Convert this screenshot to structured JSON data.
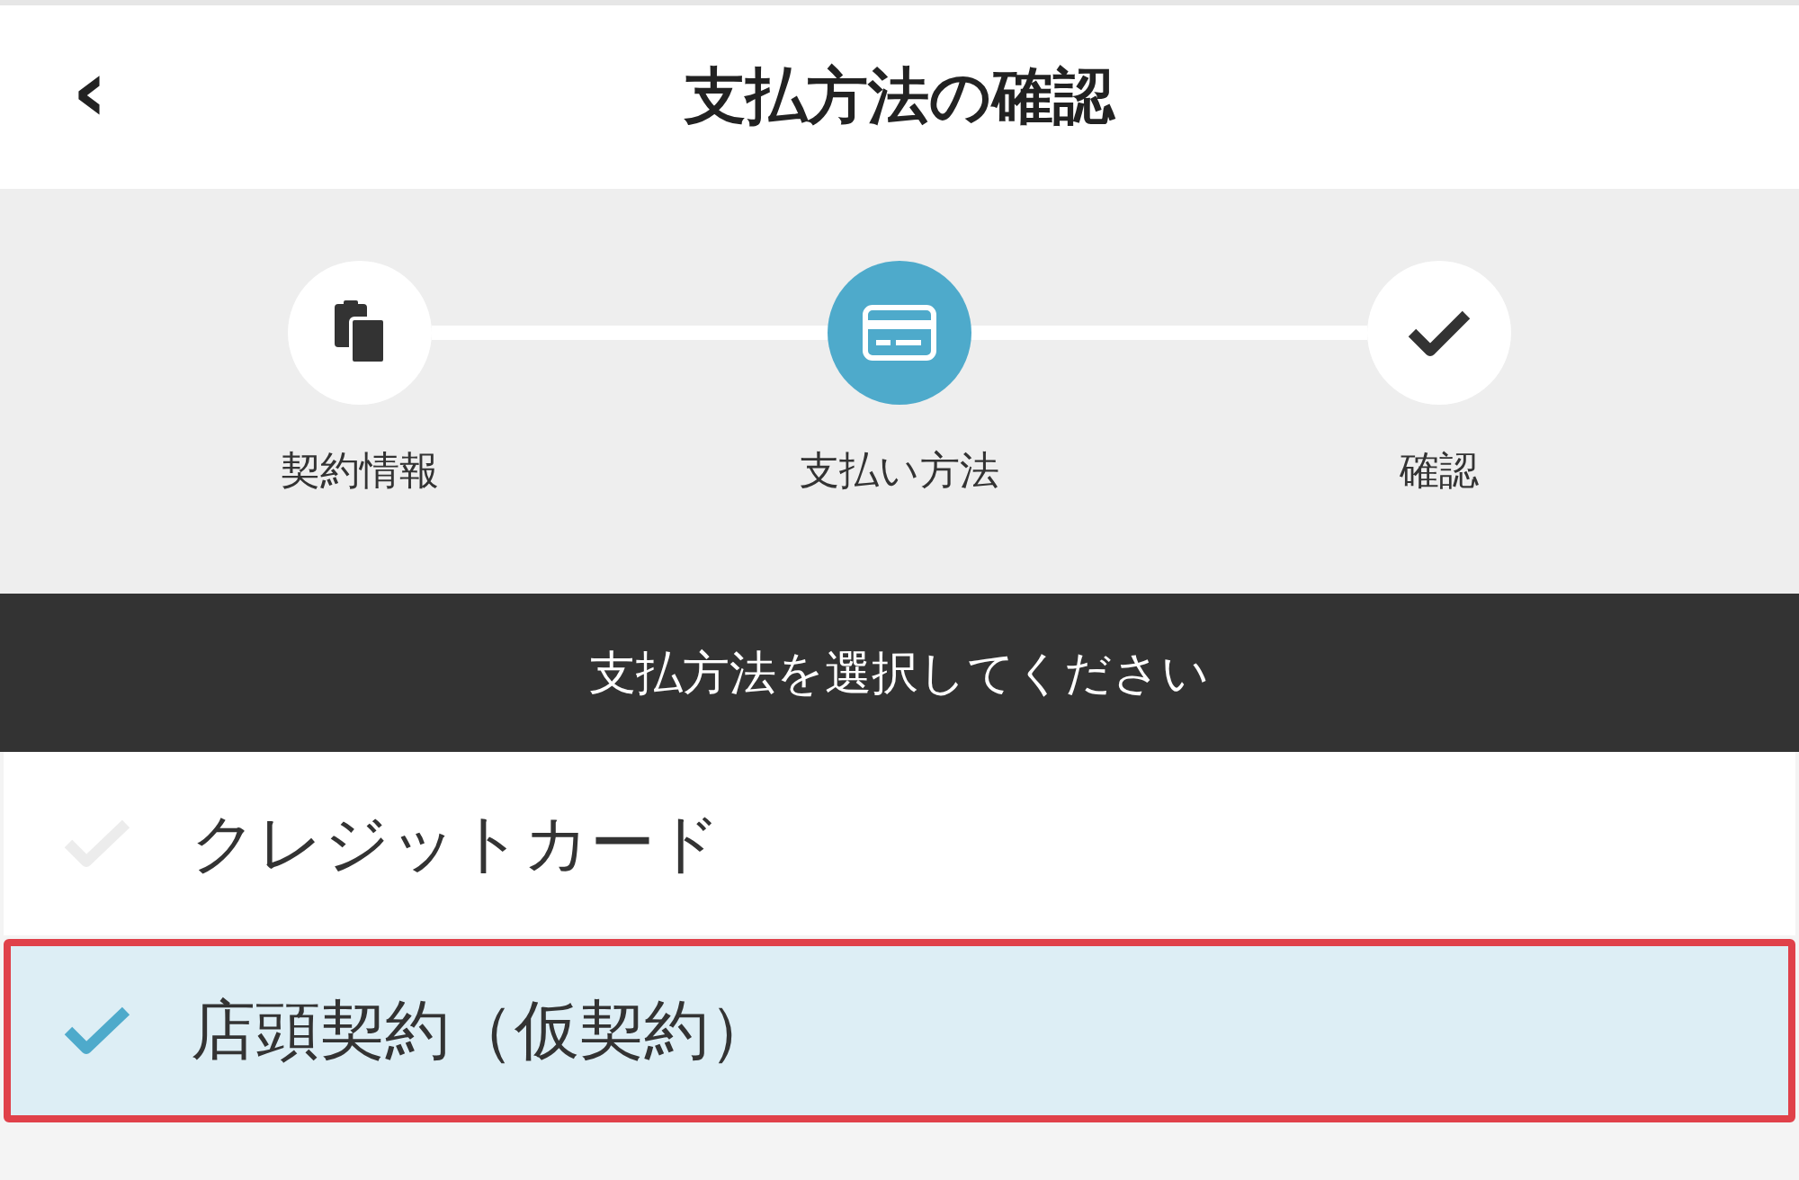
{
  "header": {
    "back_icon": "‹",
    "title": "支払方法の確認"
  },
  "steps": [
    {
      "label": "契約情報",
      "selected": false
    },
    {
      "label": "支払い方法",
      "selected": true
    },
    {
      "label": "確認",
      "selected": false
    }
  ],
  "section_title": "支払方法を選択してください",
  "options": [
    {
      "label": "クレジットカード",
      "selected": false
    },
    {
      "label": "店頭契約（仮契約）",
      "selected": true
    }
  ]
}
